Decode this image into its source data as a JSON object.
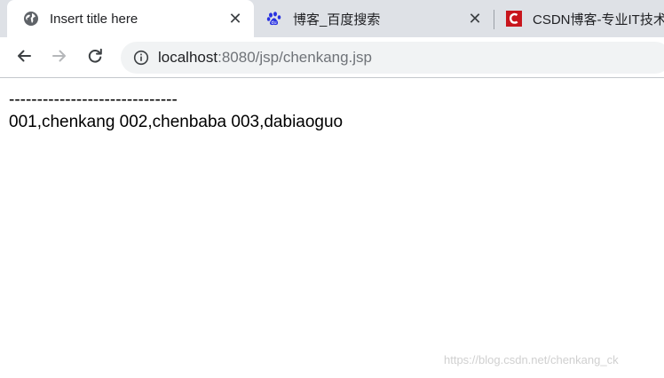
{
  "tabs": [
    {
      "title": "Insert title here",
      "favicon": "globe-icon",
      "active": true,
      "close": "✕"
    },
    {
      "title": "博客_百度搜索",
      "favicon": "baidu-paw-icon",
      "active": false,
      "close": "✕"
    },
    {
      "title": "CSDN博客-专业IT技术",
      "favicon": "csdn-logo-icon",
      "active": false
    }
  ],
  "toolbar": {
    "back_icon": "back-arrow-icon",
    "forward_icon": "forward-arrow-icon",
    "reload_icon": "reload-icon"
  },
  "address": {
    "host": "localhost",
    "rest": ":8080/jsp/chenkang.jsp",
    "info_icon": "info-icon"
  },
  "page": {
    "line1": "------------------------------",
    "line2": "001,chenkang 002,chenbaba 003,dabiaoguo"
  },
  "watermark": "https://blog.csdn.net/chenkang_ck",
  "colors": {
    "tabstrip": "#dee1e6",
    "omnibox": "#f1f3f4",
    "csdn_red": "#c8161d",
    "baidu_blue": "#2932e1"
  }
}
